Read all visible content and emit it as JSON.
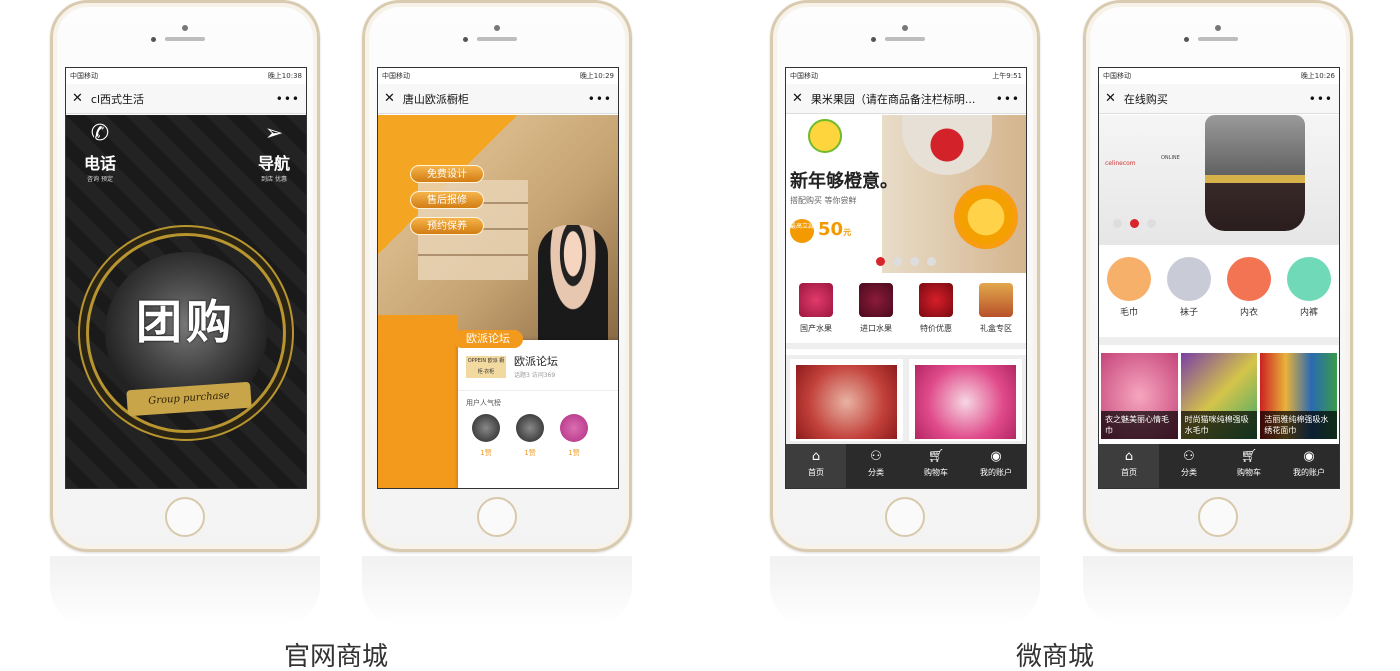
{
  "captions": {
    "left": "官网商城",
    "right": "微商城"
  },
  "phone1": {
    "carrier": "中国移动",
    "time": "晚上10:38",
    "title": "cl西式生活",
    "call_label": "电话",
    "call_sub": "咨询 预定",
    "nav_label": "导航",
    "nav_sub": "到店 优惠",
    "group_title": "团购",
    "group_banner": "Group purchase"
  },
  "phone2": {
    "carrier": "中国移动",
    "time": "晚上10:29",
    "title": "唐山欧派橱柜",
    "pills": [
      "免费设计",
      "售后报修",
      "预约保养"
    ],
    "forum_tag": "欧派论坛",
    "logo_text": "OPPEIN 欧派 橱柜·衣柜",
    "card_title": "欧派论坛",
    "card_meta": "话题3  访问369",
    "popular_label": "用户人气榜",
    "likes": [
      "1赞",
      "1赞",
      "1赞"
    ]
  },
  "phone3": {
    "carrier": "中国移动",
    "time": "上午9:51",
    "title": "果米果园（请在商品备注栏标明...",
    "headline": "新年够橙意。",
    "subline": "搭配购买  等你尝鲜",
    "badge": "最高立减",
    "price": "50",
    "price_unit": "元",
    "categories": [
      "国产水果",
      "进口水果",
      "特价优惠",
      "礼盒专区"
    ]
  },
  "phone4": {
    "carrier": "中国移动",
    "time": "晚上10:26",
    "title": "在线购买",
    "brand_left": "celinecom",
    "brand_right": "ONLINE",
    "categories": [
      "毛巾",
      "袜子",
      "内衣",
      "内裤"
    ],
    "products": [
      "衣之魅美丽心情毛巾",
      "时尚猫咪纯棉强吸水毛巾",
      "洁丽雅纯棉强吸水绣花面巾"
    ]
  },
  "tabs": [
    "首页",
    "分类",
    "购物车",
    "我的账户"
  ],
  "colors": {
    "accent_orange": "#f39a1d",
    "tabbar": "#2b2b2b",
    "gold": "#b8952e",
    "dot_active": "#d8242b"
  },
  "icons": {
    "close": "close-icon",
    "more": "more-icon",
    "home": "home-icon",
    "category": "category-icon",
    "cart": "cart-icon",
    "account": "account-icon"
  }
}
